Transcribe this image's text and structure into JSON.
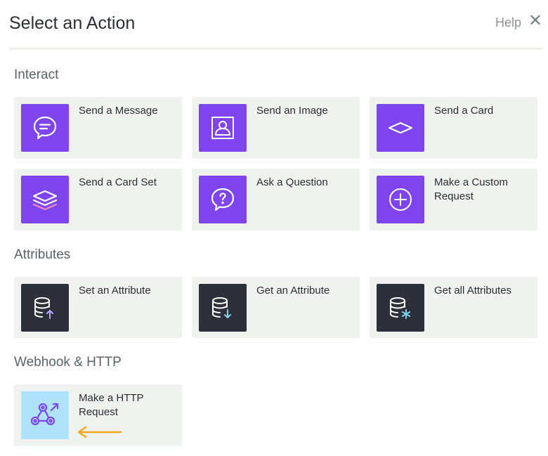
{
  "header": {
    "title": "Select an Action",
    "help_label": "Help",
    "close_glyph": "✕"
  },
  "sections": {
    "interact": {
      "title": "Interact",
      "items": [
        {
          "label": "Send a Message",
          "icon": "message-icon"
        },
        {
          "label": "Send an Image",
          "icon": "image-icon"
        },
        {
          "label": "Send a Card",
          "icon": "card-icon"
        },
        {
          "label": "Send a Card Set",
          "icon": "card-set-icon"
        },
        {
          "label": "Ask a Question",
          "icon": "question-icon"
        },
        {
          "label": "Make a Custom Request",
          "icon": "plus-circle-icon"
        }
      ]
    },
    "attributes": {
      "title": "Attributes",
      "items": [
        {
          "label": "Set an Attribute",
          "icon": "database-upload-icon"
        },
        {
          "label": "Get an Attribute",
          "icon": "database-download-icon"
        },
        {
          "label": "Get all Attributes",
          "icon": "database-asterisk-icon"
        }
      ]
    },
    "webhook": {
      "title": "Webhook & HTTP",
      "items": [
        {
          "label": "Make a HTTP Request",
          "icon": "webhook-icon"
        }
      ]
    }
  },
  "colors": {
    "accent_purple": "#7e45ee",
    "dark_tile": "#2e3039",
    "light_tile": "#aee3fb",
    "card_bg": "#eff2ef",
    "arrow": "#f4a61d"
  }
}
